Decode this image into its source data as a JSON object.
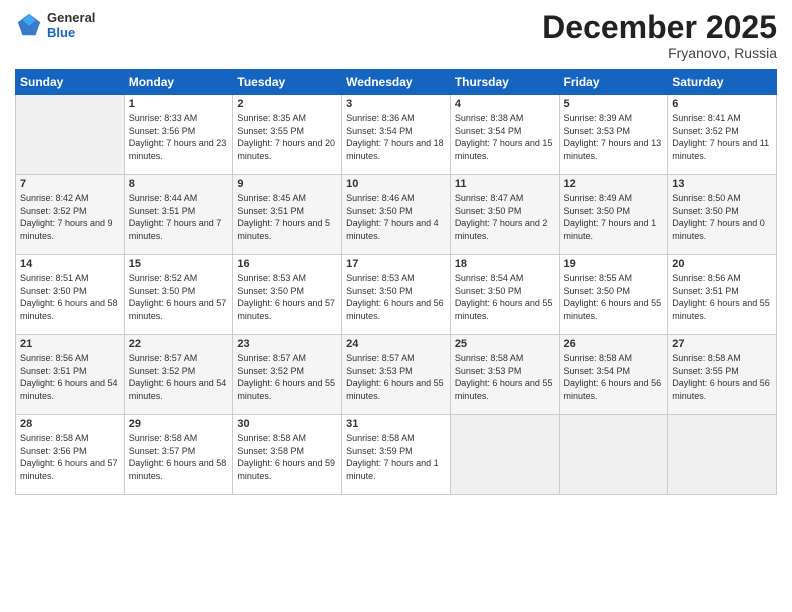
{
  "header": {
    "logo_general": "General",
    "logo_blue": "Blue",
    "month": "December 2025",
    "location": "Fryanovo, Russia"
  },
  "weekdays": [
    "Sunday",
    "Monday",
    "Tuesday",
    "Wednesday",
    "Thursday",
    "Friday",
    "Saturday"
  ],
  "weeks": [
    [
      {
        "day": "",
        "empty": true
      },
      {
        "day": "1",
        "rise": "8:33 AM",
        "set": "3:56 PM",
        "daylight": "7 hours and 23 minutes."
      },
      {
        "day": "2",
        "rise": "8:35 AM",
        "set": "3:55 PM",
        "daylight": "7 hours and 20 minutes."
      },
      {
        "day": "3",
        "rise": "8:36 AM",
        "set": "3:54 PM",
        "daylight": "7 hours and 18 minutes."
      },
      {
        "day": "4",
        "rise": "8:38 AM",
        "set": "3:54 PM",
        "daylight": "7 hours and 15 minutes."
      },
      {
        "day": "5",
        "rise": "8:39 AM",
        "set": "3:53 PM",
        "daylight": "7 hours and 13 minutes."
      },
      {
        "day": "6",
        "rise": "8:41 AM",
        "set": "3:52 PM",
        "daylight": "7 hours and 11 minutes."
      }
    ],
    [
      {
        "day": "7",
        "rise": "8:42 AM",
        "set": "3:52 PM",
        "daylight": "7 hours and 9 minutes."
      },
      {
        "day": "8",
        "rise": "8:44 AM",
        "set": "3:51 PM",
        "daylight": "7 hours and 7 minutes."
      },
      {
        "day": "9",
        "rise": "8:45 AM",
        "set": "3:51 PM",
        "daylight": "7 hours and 5 minutes."
      },
      {
        "day": "10",
        "rise": "8:46 AM",
        "set": "3:50 PM",
        "daylight": "7 hours and 4 minutes."
      },
      {
        "day": "11",
        "rise": "8:47 AM",
        "set": "3:50 PM",
        "daylight": "7 hours and 2 minutes."
      },
      {
        "day": "12",
        "rise": "8:49 AM",
        "set": "3:50 PM",
        "daylight": "7 hours and 1 minute."
      },
      {
        "day": "13",
        "rise": "8:50 AM",
        "set": "3:50 PM",
        "daylight": "7 hours and 0 minutes."
      }
    ],
    [
      {
        "day": "14",
        "rise": "8:51 AM",
        "set": "3:50 PM",
        "daylight": "6 hours and 58 minutes."
      },
      {
        "day": "15",
        "rise": "8:52 AM",
        "set": "3:50 PM",
        "daylight": "6 hours and 57 minutes."
      },
      {
        "day": "16",
        "rise": "8:53 AM",
        "set": "3:50 PM",
        "daylight": "6 hours and 57 minutes."
      },
      {
        "day": "17",
        "rise": "8:53 AM",
        "set": "3:50 PM",
        "daylight": "6 hours and 56 minutes."
      },
      {
        "day": "18",
        "rise": "8:54 AM",
        "set": "3:50 PM",
        "daylight": "6 hours and 55 minutes."
      },
      {
        "day": "19",
        "rise": "8:55 AM",
        "set": "3:50 PM",
        "daylight": "6 hours and 55 minutes."
      },
      {
        "day": "20",
        "rise": "8:56 AM",
        "set": "3:51 PM",
        "daylight": "6 hours and 55 minutes."
      }
    ],
    [
      {
        "day": "21",
        "rise": "8:56 AM",
        "set": "3:51 PM",
        "daylight": "6 hours and 54 minutes."
      },
      {
        "day": "22",
        "rise": "8:57 AM",
        "set": "3:52 PM",
        "daylight": "6 hours and 54 minutes."
      },
      {
        "day": "23",
        "rise": "8:57 AM",
        "set": "3:52 PM",
        "daylight": "6 hours and 55 minutes."
      },
      {
        "day": "24",
        "rise": "8:57 AM",
        "set": "3:53 PM",
        "daylight": "6 hours and 55 minutes."
      },
      {
        "day": "25",
        "rise": "8:58 AM",
        "set": "3:53 PM",
        "daylight": "6 hours and 55 minutes."
      },
      {
        "day": "26",
        "rise": "8:58 AM",
        "set": "3:54 PM",
        "daylight": "6 hours and 56 minutes."
      },
      {
        "day": "27",
        "rise": "8:58 AM",
        "set": "3:55 PM",
        "daylight": "6 hours and 56 minutes."
      }
    ],
    [
      {
        "day": "28",
        "rise": "8:58 AM",
        "set": "3:56 PM",
        "daylight": "6 hours and 57 minutes."
      },
      {
        "day": "29",
        "rise": "8:58 AM",
        "set": "3:57 PM",
        "daylight": "6 hours and 58 minutes."
      },
      {
        "day": "30",
        "rise": "8:58 AM",
        "set": "3:58 PM",
        "daylight": "6 hours and 59 minutes."
      },
      {
        "day": "31",
        "rise": "8:58 AM",
        "set": "3:59 PM",
        "daylight": "7 hours and 1 minute."
      },
      {
        "day": "",
        "empty": true
      },
      {
        "day": "",
        "empty": true
      },
      {
        "day": "",
        "empty": true
      }
    ]
  ]
}
